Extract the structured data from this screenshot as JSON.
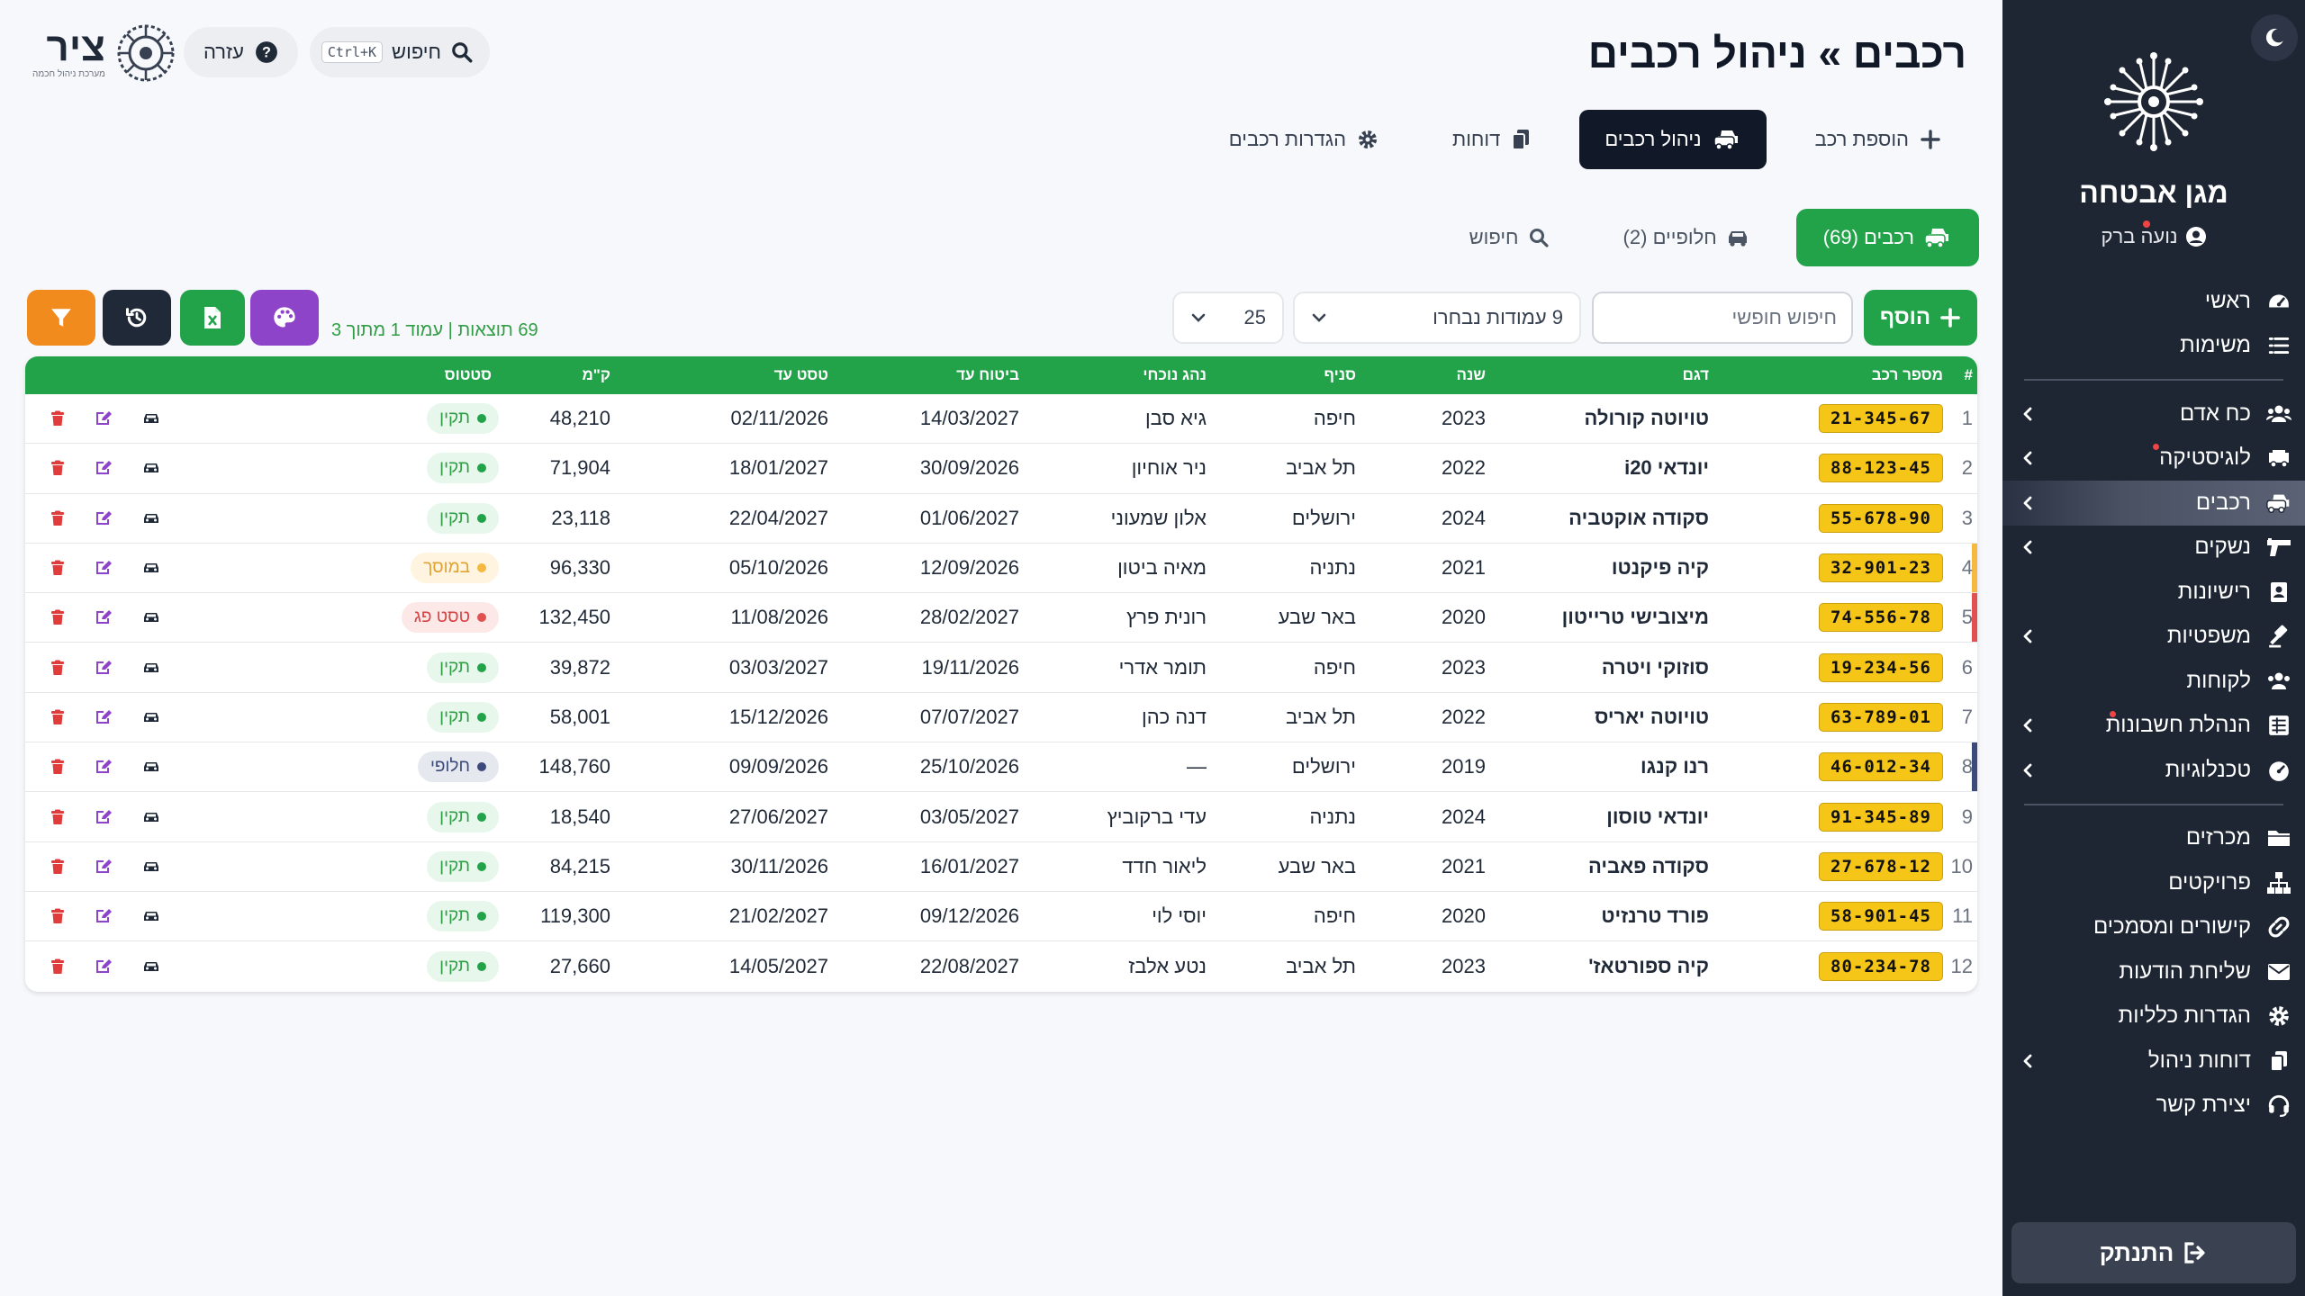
{
  "header": {
    "title": "רכבים » ניהול רכבים",
    "logo_word": "ציר",
    "logo_sub": "מערכת ניהול חכמה",
    "help_label": "עזרה",
    "search_label": "חיפוש",
    "search_shortcut": "Ctrl+K"
  },
  "tabs": [
    {
      "label": "הוספת רכב",
      "icon": "plus-icon"
    },
    {
      "label": "ניהול רכבים",
      "icon": "cars-icon",
      "active": true
    },
    {
      "label": "דוחות",
      "icon": "copy-icon"
    },
    {
      "label": "הגדרות רכבים",
      "icon": "gear-icon"
    }
  ],
  "subtabs": [
    {
      "label": "רכבים (69)",
      "icon": "cars-icon",
      "active": true
    },
    {
      "label": "חלופיים (2)",
      "icon": "car-icon"
    },
    {
      "label": "חיפוש",
      "icon": "search-icon"
    }
  ],
  "toolbar": {
    "add_label": "הוסף",
    "search_placeholder": "חיפוש חופשי",
    "columns_label": "9 עמודות נבחרו",
    "per_page": "25",
    "results_info": "69 תוצאות | עמוד 1 מתוך 3"
  },
  "table": {
    "headers": {
      "num": "#",
      "plate": "מספר רכב",
      "model": "דגם",
      "year": "שנה",
      "branch": "סניף",
      "driver": "נהג נוכחי",
      "insurance": "ביטוח עד",
      "test": "טסט עד",
      "km": "ק\"מ",
      "status": "סטטוס"
    },
    "rows": [
      {
        "num": "1",
        "plate": "21-345-67",
        "model": "טויוטה קורולה",
        "year": "2023",
        "branch": "חיפה",
        "driver": "גיא סבן",
        "insurance": "14/03/2027",
        "test": "02/11/2026",
        "km": "48,210",
        "status": "תקין",
        "status_type": "ok",
        "accent": ""
      },
      {
        "num": "2",
        "plate": "88-123-45",
        "model": "יונדאי i20",
        "year": "2022",
        "branch": "תל אביב",
        "driver": "ניר אוחיון",
        "insurance": "30/09/2026",
        "test": "18/01/2027",
        "km": "71,904",
        "status": "תקין",
        "status_type": "ok",
        "accent": ""
      },
      {
        "num": "3",
        "plate": "55-678-90",
        "model": "סקודה אוקטביה",
        "year": "2024",
        "branch": "ירושלים",
        "driver": "אלון שמעוני",
        "insurance": "01/06/2027",
        "test": "22/04/2027",
        "km": "23,118",
        "status": "תקין",
        "status_type": "ok",
        "accent": ""
      },
      {
        "num": "4",
        "plate": "32-901-23",
        "model": "קיה פיקנטו",
        "year": "2021",
        "branch": "נתניה",
        "driver": "מאיה ביטון",
        "insurance": "12/09/2026",
        "test": "05/10/2026",
        "km": "96,330",
        "status": "במוסך",
        "status_type": "garage",
        "accent": "#f5b942"
      },
      {
        "num": "5",
        "plate": "74-556-78",
        "model": "מיצובישי טרייטון",
        "year": "2020",
        "branch": "באר שבע",
        "driver": "רונית פרץ",
        "insurance": "28/02/2027",
        "test": "11/08/2026",
        "km": "132,450",
        "status": "טסט פג",
        "status_type": "expired",
        "accent": "#e05252"
      },
      {
        "num": "6",
        "plate": "19-234-56",
        "model": "סוזוקי ויטרה",
        "year": "2023",
        "branch": "חיפה",
        "driver": "תומר אדרי",
        "insurance": "19/11/2026",
        "test": "03/03/2027",
        "km": "39,872",
        "status": "תקין",
        "status_type": "ok",
        "accent": ""
      },
      {
        "num": "7",
        "plate": "63-789-01",
        "model": "טויוטה יאריס",
        "year": "2022",
        "branch": "תל אביב",
        "driver": "דנה כהן",
        "insurance": "07/07/2027",
        "test": "15/12/2026",
        "km": "58,001",
        "status": "תקין",
        "status_type": "ok",
        "accent": ""
      },
      {
        "num": "8",
        "plate": "46-012-34",
        "model": "רנו קנגו",
        "year": "2019",
        "branch": "ירושלים",
        "driver": "—",
        "insurance": "25/10/2026",
        "test": "09/09/2026",
        "km": "148,760",
        "status": "חלופי",
        "status_type": "spare",
        "accent": "#3b4a7a"
      },
      {
        "num": "9",
        "plate": "91-345-89",
        "model": "יונדאי טוסון",
        "year": "2024",
        "branch": "נתניה",
        "driver": "עדי ברקוביץ",
        "insurance": "03/05/2027",
        "test": "27/06/2027",
        "km": "18,540",
        "status": "תקין",
        "status_type": "ok",
        "accent": ""
      },
      {
        "num": "10",
        "plate": "27-678-12",
        "model": "סקודה פאביה",
        "year": "2021",
        "branch": "באר שבע",
        "driver": "ליאור חדד",
        "insurance": "16/01/2027",
        "test": "30/11/2026",
        "km": "84,215",
        "status": "תקין",
        "status_type": "ok",
        "accent": ""
      },
      {
        "num": "11",
        "plate": "58-901-45",
        "model": "פורד טרנזיט",
        "year": "2020",
        "branch": "חיפה",
        "driver": "יוסי לוי",
        "insurance": "09/12/2026",
        "test": "21/02/2027",
        "km": "119,300",
        "status": "תקין",
        "status_type": "ok",
        "accent": ""
      },
      {
        "num": "12",
        "plate": "80-234-78",
        "model": "קיה ספורטאז'",
        "year": "2023",
        "branch": "תל אביב",
        "driver": "נטע אלבז",
        "insurance": "22/08/2027",
        "test": "14/05/2027",
        "km": "27,660",
        "status": "תקין",
        "status_type": "ok",
        "accent": ""
      }
    ]
  },
  "sidebar": {
    "org_name": "מגן אבטחה",
    "user_name": "נועה ברק",
    "logout_label": "התנתק",
    "groups": [
      [
        {
          "label": "ראשי",
          "icon": "dashboard-icon"
        },
        {
          "label": "משימות",
          "icon": "tasks-icon"
        }
      ],
      [
        {
          "label": "כח אדם",
          "icon": "users-icon",
          "chevron": true
        },
        {
          "label": "לוגיסטיקה",
          "icon": "truck-icon",
          "chevron": true,
          "dot": true
        },
        {
          "label": "רכבים",
          "icon": "cars-icon",
          "chevron": true,
          "active": true
        },
        {
          "label": "נשקים",
          "icon": "gun-icon",
          "chevron": true
        },
        {
          "label": "רישיונות",
          "icon": "id-badge-icon"
        },
        {
          "label": "משפטיות",
          "icon": "gavel-icon",
          "chevron": true
        },
        {
          "label": "לקוחות",
          "icon": "clients-icon"
        },
        {
          "label": "הנהלת חשבונות",
          "icon": "ledger-icon",
          "chevron": true,
          "dot": true
        },
        {
          "label": "טכנלוגיות",
          "icon": "gauge-icon",
          "chevron": true
        }
      ],
      [
        {
          "label": "מכרזים",
          "icon": "folder-icon"
        },
        {
          "label": "פרויקטים",
          "icon": "sitemap-icon"
        },
        {
          "label": "קישורים ומסמכים",
          "icon": "link-icon"
        },
        {
          "label": "שליחת הודעות",
          "icon": "envelope-icon"
        },
        {
          "label": "הגדרות כלליות",
          "icon": "gear-icon"
        },
        {
          "label": "דוחות ניהול",
          "icon": "copy-icon",
          "chevron": true
        },
        {
          "label": "יצירת קשר",
          "icon": "headset-icon"
        }
      ]
    ]
  },
  "colors": {
    "green": "#22a34a",
    "sidebar_bg": "#1e2533",
    "plate_yellow": "#f5c518",
    "palette_btn": "#8e44c9",
    "excel_btn": "#22a34a",
    "reset_btn": "#1f2937",
    "filter_btn": "#f28b1e"
  }
}
